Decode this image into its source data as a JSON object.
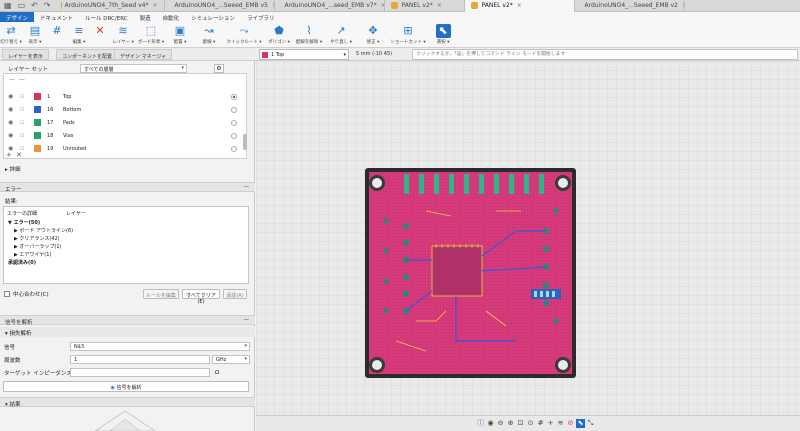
{
  "document_tabs": [
    {
      "label": "ArduinoUNO4_7th_Seed v4*",
      "active": false
    },
    {
      "label": "ArduinoUNO4_...Seeed_EMB v5",
      "active": false
    },
    {
      "label": "ArduinoUNO4_...seed_EMB v7*",
      "active": false
    },
    {
      "label": "PANEL v2*",
      "active": false
    },
    {
      "label": "PANEL v2*",
      "active": true
    },
    {
      "label": "ArduinoUNO4_...Seeed_EMB v2",
      "active": false
    }
  ],
  "ribbon": {
    "tabs": [
      "デザイン",
      "ドキュメント",
      "ルール DRC/ERC",
      "製造",
      "自動化",
      "シミュレーション",
      "ライブラリ"
    ],
    "active_tab": "デザイン",
    "tools": [
      {
        "name": "switch",
        "icon": "switch-icon",
        "label": "切り替え ▾"
      },
      {
        "name": "display",
        "icon": "display-icon",
        "label": "表示 ▾"
      },
      {
        "name": "grid",
        "icon": "grid-icon",
        "label": ""
      },
      {
        "name": "edit",
        "icon": "edit-icon",
        "label": "編集 ▾"
      },
      {
        "name": "delete",
        "icon": "delete-icon",
        "label": ""
      },
      {
        "name": "layer",
        "icon": "layer-icon",
        "label": "レイヤー ▾"
      },
      {
        "name": "board-outline",
        "icon": "board-outline-icon",
        "label": "ボード形状 ▾"
      },
      {
        "name": "place",
        "icon": "place-icon",
        "label": "配置 ▾"
      },
      {
        "name": "route",
        "icon": "route-icon",
        "label": "配線 ▾"
      },
      {
        "name": "quick-route",
        "icon": "quick-route-icon",
        "label": "クイックルート ▾"
      },
      {
        "name": "polygon",
        "icon": "polygon-icon",
        "label": "ポリゴン ▾"
      },
      {
        "name": "unroute",
        "icon": "unroute-icon",
        "label": "配線を解除 ▾"
      },
      {
        "name": "redo-route",
        "icon": "redo-route-icon",
        "label": "やり直し ▾"
      },
      {
        "name": "modify",
        "icon": "modify-icon",
        "label": "修正 ▾"
      },
      {
        "name": "shortcut",
        "icon": "shortcut-icon",
        "label": "ショートカット ▾"
      },
      {
        "name": "select",
        "icon": "select-icon",
        "label": "選択 ▾"
      }
    ]
  },
  "subbar": {
    "panel_tabs": [
      "レイヤーを表示",
      "コンポーネントを配置",
      "デザイン マネージャ"
    ],
    "active_layer": {
      "label": "1 Top",
      "color": "#d9345d"
    },
    "grid_readout": "5 mm (-10 45)",
    "command_placeholder": "クリックするか、「@」を押してコマンド ライン モードを開始します"
  },
  "layers_panel": {
    "label": "レイヤー セット",
    "set_value": "すべての層層",
    "layers": [
      {
        "num": "1",
        "name": "Top",
        "color": "#d9345d",
        "selected": true
      },
      {
        "num": "16",
        "name": "Bottom",
        "color": "#2d62c5",
        "selected": false
      },
      {
        "num": "17",
        "name": "Pads",
        "color": "#27a06a",
        "selected": false
      },
      {
        "num": "18",
        "name": "Vias",
        "color": "#27a06a",
        "selected": false
      },
      {
        "num": "19",
        "name": "Unrouted",
        "color": "#e59a37",
        "selected": false
      }
    ],
    "details_label": "詳細"
  },
  "errors_panel": {
    "header": "エラー",
    "results_label": "結果:",
    "col_details": "エラーの詳細",
    "col_layer": "レイヤー",
    "tree": [
      {
        "text": "▼ エラー(50)",
        "indent": 0,
        "bold": true
      },
      {
        "text": "▶ ボード アウトライン(6)",
        "indent": 1,
        "bold": false
      },
      {
        "text": "▶ クリアランス(42)",
        "indent": 1,
        "bold": false
      },
      {
        "text": "▶ オーバーラップ(1)",
        "indent": 1,
        "bold": false
      },
      {
        "text": "▶ エアワイヤ(1)",
        "indent": 1,
        "bold": false
      },
      {
        "text": "承認済み(0)",
        "indent": 0,
        "bold": true
      }
    ],
    "center_label": "中心合わせ(C)",
    "buttons": [
      {
        "label": "ルールを編集",
        "enabled": false
      },
      {
        "label": "すべてクリア(E)",
        "enabled": true
      },
      {
        "label": "承認(A)",
        "enabled": false
      }
    ]
  },
  "signal_panel": {
    "header": "信号を解析",
    "section": "損失解析",
    "signal_label": "信号",
    "signal_value": "N$3",
    "freq_label": "周波数",
    "freq_value": "1",
    "freq_unit": "GHz",
    "impedance_label": "ターゲット インピーダンス(Z0)",
    "impedance_unit": "Ω",
    "analyze_button": "信号を解析",
    "result_header": "結果"
  },
  "bottom_toolbar": {
    "icons": [
      "info-icon",
      "eye-icon",
      "zoom-out-icon",
      "zoom-in-icon",
      "zoom-fit-icon",
      "zoom-select-icon",
      "grid-icon",
      "plus-icon",
      "layer-icon",
      "stop-icon",
      "cursor-icon",
      "measure-icon"
    ]
  }
}
